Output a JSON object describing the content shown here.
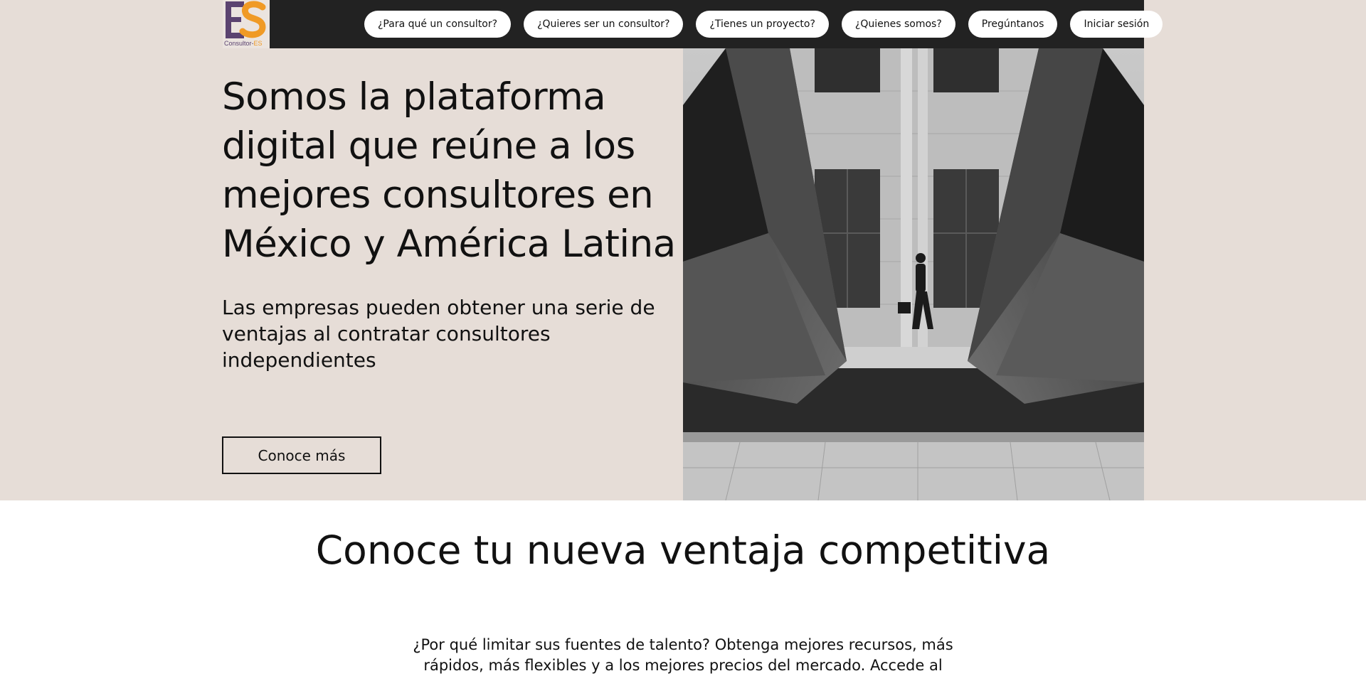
{
  "brand": {
    "name_prefix": "Consultor-",
    "name_suffix": "ES",
    "colors": {
      "purple": "#5b4370",
      "orange": "#f09a25"
    }
  },
  "nav": {
    "items": [
      {
        "label": "¿Para qué un consultor?"
      },
      {
        "label": "¿Quieres ser un consultor?"
      },
      {
        "label": "¿Tienes un proyecto?"
      },
      {
        "label": "¿Quienes somos?"
      },
      {
        "label": "Pregúntanos"
      },
      {
        "label": "Iniciar sesión"
      }
    ]
  },
  "hero": {
    "title": "Somos la plataforma digital que reúne a los mejores consultores en México y América Latina",
    "subtitle": "Las empresas pueden obtener una serie de ventajas al contratar consultores independientes",
    "cta_label": "Conoce más",
    "background_color": "#e6ddd7"
  },
  "section": {
    "title": "Conoce tu nueva ventaja competitiva",
    "body": "¿Por qué limitar sus fuentes de talento? Obtenga mejores recursos, más rápidos, más flexibles y a los mejores precios del mercado. Accede al"
  }
}
